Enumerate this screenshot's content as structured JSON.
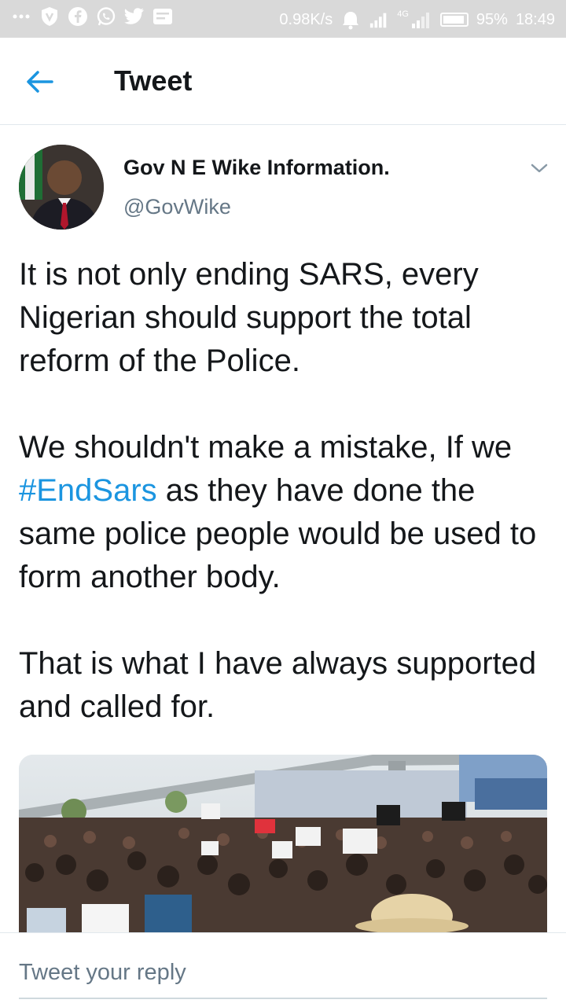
{
  "status_bar": {
    "network_speed": "0.98K/s",
    "network_badge": "4G",
    "battery": "95%",
    "time": "18:49"
  },
  "header": {
    "title": "Tweet"
  },
  "tweet": {
    "author_name": "Gov N E Wike Information.",
    "author_handle": "@GovWike",
    "paragraph1": "It is not only ending SARS, every Nigerian should support the total reform of the Police.",
    "paragraph2_before": "We shouldn't make a mistake, If we ",
    "hashtag": "#EndSars",
    "paragraph2_after": " as they have done the same police people would be used to form another body.",
    "paragraph3": "That is what I have always supported and called for."
  },
  "reply": {
    "placeholder": "Tweet your reply"
  },
  "colors": {
    "accent": "#1b95e0",
    "status_bar": "#d9d9d9",
    "secondary_text": "#657786"
  }
}
